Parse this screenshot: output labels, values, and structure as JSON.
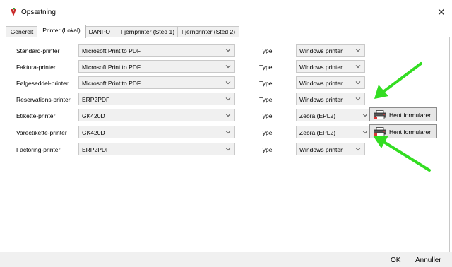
{
  "window": {
    "title": "Opsætning",
    "close_glyph": "✕",
    "icon": "red-green-app-icon"
  },
  "tabs": [
    {
      "label": "Generelt",
      "active": false
    },
    {
      "label": "Printer (Lokal)",
      "active": true
    },
    {
      "label": "DANPOT",
      "active": false
    },
    {
      "label": "Fjernprinter (Sted 1)",
      "active": false
    },
    {
      "label": "Fjernprinter (Sted 2)",
      "active": false
    }
  ],
  "type_label": "Type",
  "rows": [
    {
      "label": "Standard-printer",
      "printer": "Microsoft Print to PDF",
      "type": "Windows printer"
    },
    {
      "label": "Faktura-printer",
      "printer": "Microsoft Print to PDF",
      "type": "Windows printer"
    },
    {
      "label": "Følgeseddel-printer",
      "printer": "Microsoft Print to PDF",
      "type": "Windows printer"
    },
    {
      "label": "Reservations-printer",
      "printer": "ERP2PDF",
      "type": "Windows printer"
    },
    {
      "label": "Etikette-printer",
      "printer": "GK420D",
      "type": "Zebra (EPL2)",
      "button": "Hent formularer"
    },
    {
      "label": "Vareetikette-printer",
      "printer": "GK420D",
      "type": "Zebra (EPL2)",
      "button": "Hent formularer"
    },
    {
      "label": "Factoring-printer",
      "printer": "ERP2PDF",
      "type": "Windows printer"
    }
  ],
  "footer": {
    "ok": "OK",
    "cancel": "Annuller"
  },
  "colors": {
    "arrow": "#33dd22",
    "combo_bg": "#f0f0f0",
    "border": "#c8c8c8"
  }
}
